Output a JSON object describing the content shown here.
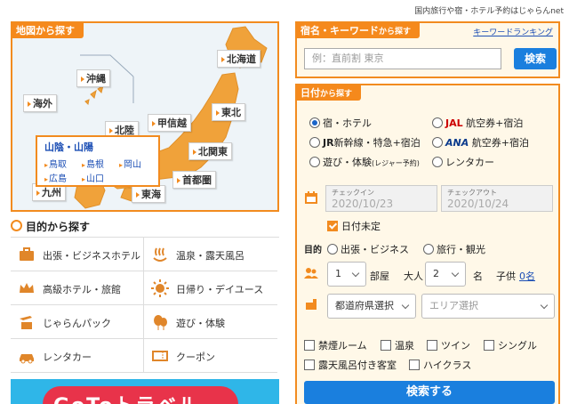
{
  "header": {
    "tagline": "国内旅行や宿・ホテル予約はじゃらんnet"
  },
  "map": {
    "tab_label": "地図から探す",
    "regions": [
      "北海道",
      "沖縄",
      "海外",
      "北陸",
      "甲信越",
      "東北",
      "北関東",
      "首都圏",
      "九州",
      "東海"
    ],
    "popup": {
      "title": "山陰・山陽",
      "links": [
        "鳥取",
        "島根",
        "岡山",
        "広島",
        "山口"
      ]
    }
  },
  "purpose": {
    "heading": "目的から探す",
    "items": [
      "出張・ビジネスホテル",
      "温泉・露天風呂",
      "高級ホテル・旅館",
      "日帰り・デイユース",
      "じゃらんパック",
      "遊び・体験",
      "レンタカー",
      "クーポン"
    ]
  },
  "keyword": {
    "tab_main": "宿名・キーワード",
    "tab_small": "から探す",
    "ranking_link": "キーワードランキング",
    "placeholder": "例：直前割 東京",
    "search_button": "検索"
  },
  "date": {
    "tab_main": "日付",
    "tab_small": "から探す",
    "types": [
      {
        "label": "宿・ホテル",
        "selected": true
      },
      {
        "label": "航空券+宿泊",
        "brand": "JAL",
        "selected": false
      },
      {
        "label": "新幹線・特急+宿泊",
        "brand": "JR",
        "selected": false
      },
      {
        "label": "航空券+宿泊",
        "brand": "ANA",
        "selected": false
      },
      {
        "label": "遊び・体験",
        "note": "(レジャー予約)",
        "selected": false
      },
      {
        "label": "レンタカー",
        "selected": false
      }
    ],
    "checkin_label": "チェックイン",
    "checkin_value": "2020/10/23",
    "checkout_label": "チェックアウト",
    "checkout_value": "2020/10/24",
    "undecided_label": "日付未定",
    "purpose_label": "目的",
    "purpose_options": [
      "出張・ビジネス",
      "旅行・観光"
    ],
    "rooms_value": "1",
    "rooms_unit": "部屋",
    "adults_label": "大人",
    "adults_value": "2",
    "adults_unit": "名",
    "children_label": "子供",
    "children_value": "0名",
    "prefecture": "都道府県選択",
    "area": "エリア選択",
    "options": [
      "禁煙ルーム",
      "温泉",
      "ツイン",
      "シングル",
      "露天風呂付き客室",
      "ハイクラス"
    ],
    "search_button": "検索する"
  },
  "banner": {
    "text": "GoToトラベル"
  },
  "colors": {
    "accent": "#f28b1f",
    "button": "#1a7fde",
    "link": "#1c4fb5"
  }
}
